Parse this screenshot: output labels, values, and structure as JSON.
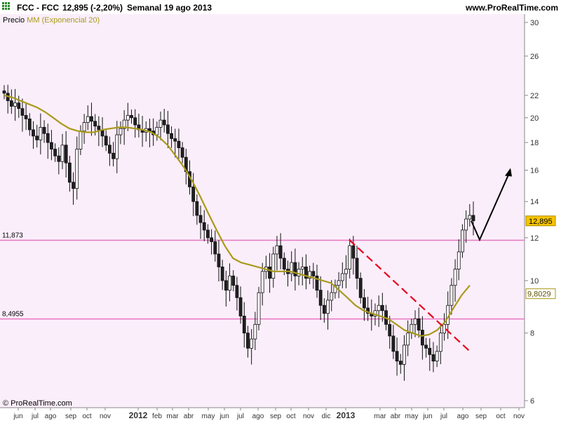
{
  "header": {
    "title": "FCC - FCC",
    "price_change": "12,895 (-2,20%)",
    "period": "Semanal",
    "date": "19 ago 2013",
    "site": "www.ProRealTime.com"
  },
  "legend": {
    "price_label": "Precio",
    "ma_label": "MM (Exponencial 20)",
    "ma_color": "#a89a1a"
  },
  "footer": {
    "credit": "© ProRealTime.com"
  },
  "colors": {
    "background": "#fbeefb",
    "up_candle": "#ffffff",
    "down_candle": "#202020",
    "support_lines": "#e87cc4",
    "trend_line": "#e8001e",
    "projection_arrow": "#000000",
    "last_price_badge": "#f5c400"
  },
  "chart_data": {
    "type": "candlestick",
    "title": "FCC - FCC",
    "timeframe": "Semanal",
    "y_scale": "log",
    "ylim": [
      5.8,
      31.5
    ],
    "y_ticks": [
      "6",
      "8",
      "10",
      "12",
      "14",
      "16",
      "18",
      "20",
      "22",
      "26",
      "30"
    ],
    "x_ticks": [
      "jun",
      "jul",
      "ago",
      "sep",
      "oct",
      "nov",
      "2012",
      "feb",
      "mar",
      "abr",
      "may",
      "jun",
      "jul",
      "ago",
      "sep",
      "oct",
      "nov",
      "dic",
      "2013",
      "mar",
      "abr",
      "may",
      "jun",
      "jul",
      "ago",
      "sep",
      "oct",
      "nov"
    ],
    "last_price": "12,895",
    "ma_last_value": "9,8029",
    "horizontal_levels": [
      {
        "label": "11,873",
        "value": 11.873
      },
      {
        "label": "8,4955",
        "value": 8.4955
      }
    ],
    "close_series": [
      22.2,
      21.5,
      21.0,
      21.3,
      20.8,
      20.2,
      19.9,
      19.0,
      18.5,
      18.2,
      19.2,
      18.7,
      18.0,
      17.5,
      17.0,
      16.6,
      17.8,
      16.5,
      15.2,
      14.8,
      17.5,
      18.9,
      19.6,
      20.1,
      19.7,
      19.3,
      19.0,
      18.5,
      17.8,
      17.2,
      16.8,
      18.6,
      19.1,
      19.8,
      20.2,
      20.0,
      19.4,
      19.0,
      18.8,
      19.1,
      18.9,
      18.6,
      19.2,
      19.8,
      19.4,
      18.7,
      18.3,
      18.1,
      17.6,
      16.9,
      15.9,
      14.9,
      14.0,
      13.2,
      12.8,
      12.4,
      12.0,
      11.8,
      11.2,
      10.6,
      10.0,
      9.6,
      10.2,
      9.8,
      9.3,
      8.6,
      8.0,
      7.5,
      7.8,
      8.3,
      9.5,
      10.4,
      10.6,
      10.1,
      11.2,
      11.6,
      11.0,
      10.5,
      10.3,
      10.8,
      10.2,
      10.5,
      10.6,
      10.1,
      10.4,
      10.2,
      9.6,
      9.0,
      8.7,
      9.2,
      9.5,
      9.8,
      10.0,
      10.3,
      10.5,
      11.6,
      11.0,
      10.1,
      9.3,
      8.9,
      8.7,
      8.6,
      8.8,
      9.0,
      8.8,
      8.3,
      7.9,
      7.4,
      7.1,
      7.0,
      7.6,
      8.0,
      8.3,
      8.5,
      8.1,
      7.6,
      7.5,
      7.3,
      7.1,
      7.4,
      8.0,
      8.3,
      9.0,
      9.8,
      10.5,
      11.3,
      12.4,
      13.0,
      13.2,
      12.9
    ],
    "ma_series": [
      22.0,
      21.8,
      21.5,
      21.2,
      20.9,
      20.5,
      20.0,
      19.5,
      19.1,
      18.9,
      18.8,
      18.8,
      19.0,
      19.1,
      19.2,
      19.2,
      19.1,
      19.0,
      18.8,
      18.4,
      17.8,
      17.0,
      16.2,
      15.3,
      14.3,
      13.3,
      12.4,
      11.6,
      11.0,
      10.8,
      10.7,
      10.6,
      10.5,
      10.4,
      10.4,
      10.4,
      10.3,
      10.2,
      10.1,
      10.0,
      9.9,
      9.6,
      9.3,
      9.0,
      8.8,
      8.7,
      8.6,
      8.5,
      8.3,
      8.1,
      8.0,
      7.9,
      7.95,
      8.1,
      8.4,
      8.9,
      9.4,
      9.8
    ],
    "downtrend_line": {
      "from": {
        "date": "2013-01",
        "value": 11.9
      },
      "to": {
        "date": "2013-08",
        "value": 7.4
      }
    },
    "projection_arrow": [
      {
        "date": "2013-08",
        "value": 12.9
      },
      {
        "date": "2013-09",
        "value": 11.9
      },
      {
        "date": "2013-10",
        "value": 16.0
      }
    ]
  }
}
